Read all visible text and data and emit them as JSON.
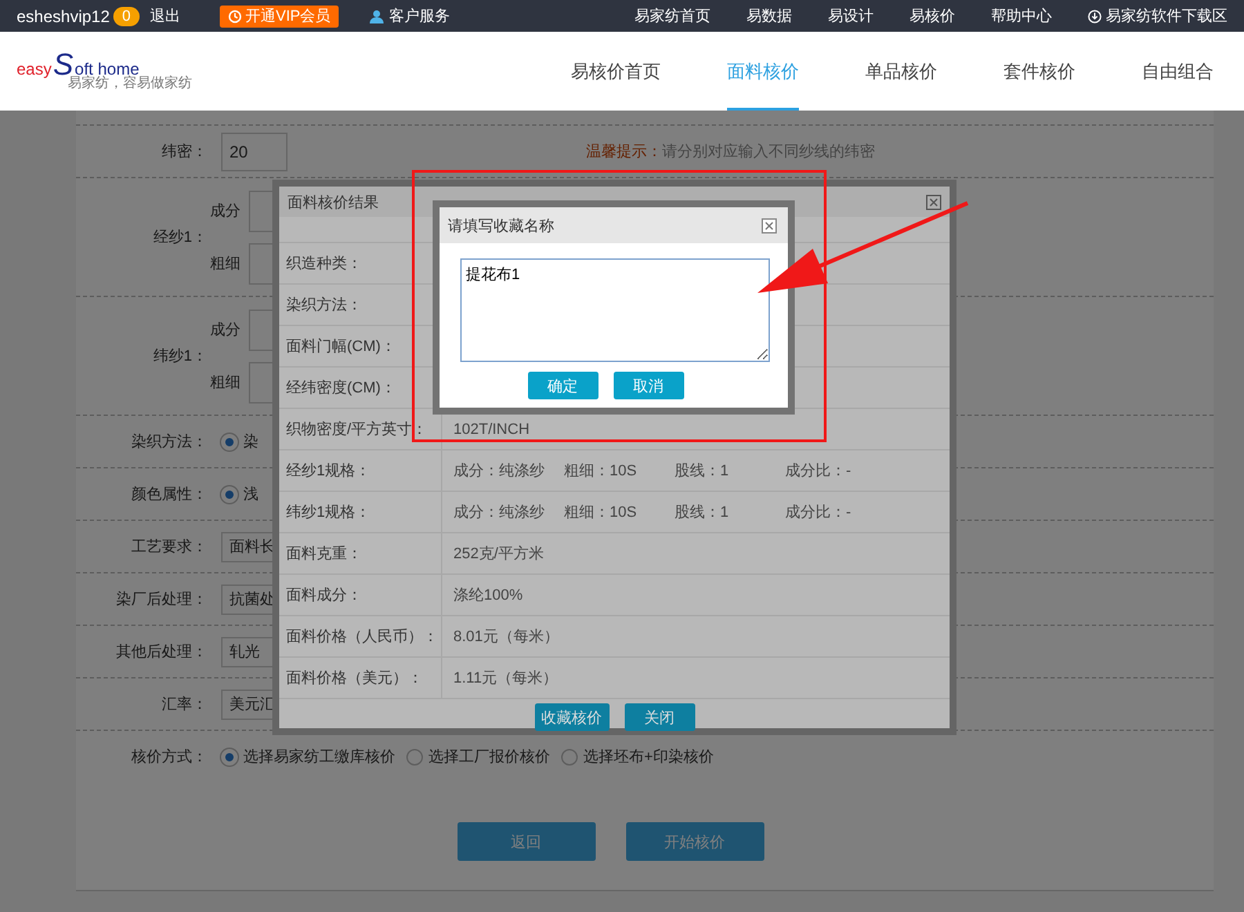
{
  "top_bar": {
    "username": "esheshvip12",
    "badge": "0",
    "logout": "退出",
    "vip_button": "开通VIP会员",
    "service": "客户服务",
    "links": [
      "易家纺首页",
      "易数据",
      "易设计",
      "易核价",
      "帮助中心"
    ],
    "download": "易家纺软件下载区"
  },
  "header": {
    "logo": {
      "word1": "easy",
      "letter": "S",
      "word2": "oft home",
      "tagline": "易家纺，容易做家纺"
    },
    "nav": [
      {
        "label": "易核价首页",
        "selected": false
      },
      {
        "label": "面料核价",
        "selected": true
      },
      {
        "label": "单品核价",
        "selected": false
      },
      {
        "label": "套件核价",
        "selected": false
      },
      {
        "label": "自由组合",
        "selected": false
      }
    ]
  },
  "form": {
    "rows": [
      {
        "kind": "input",
        "label": "纬密：",
        "value": "20",
        "hint_label": "温馨提示：",
        "hint_text": "请分别对应输入不同纱线的纬密"
      },
      {
        "kind": "yarn",
        "label": "经纱1：",
        "sub_labels": [
          "成分",
          "粗细"
        ]
      },
      {
        "kind": "yarn",
        "label": "纬纱1：",
        "sub_labels": [
          "成分",
          "粗细"
        ]
      },
      {
        "kind": "radio",
        "label": "染织方法：",
        "options": [
          {
            "label": "染",
            "selected": true
          }
        ]
      },
      {
        "kind": "radio",
        "label": "颜色属性：",
        "options": [
          {
            "label": "浅",
            "selected": true
          }
        ]
      },
      {
        "kind": "input",
        "label": "工艺要求：",
        "value": "面料长"
      },
      {
        "kind": "input",
        "label": "染厂后处理：",
        "value": "抗菌处"
      },
      {
        "kind": "input",
        "label": "其他后处理：",
        "value": "轧光"
      },
      {
        "kind": "input",
        "label": "汇率：",
        "value": "美元汇"
      },
      {
        "kind": "radio",
        "label": "核价方式：",
        "options": [
          {
            "label": "选择易家纺工缴库核价",
            "selected": true
          },
          {
            "label": "选择工厂报价核价",
            "selected": false
          },
          {
            "label": "选择坯布+印染核价",
            "selected": false
          }
        ]
      }
    ],
    "buttons": [
      "返回",
      "开始核价"
    ]
  },
  "result_dialog": {
    "title": "面料核价结果",
    "rows": [
      {
        "label": "织造种类："
      },
      {
        "label": "染织方法："
      },
      {
        "label": "面料门幅(CM)："
      },
      {
        "label": "经纬密度(CM)："
      },
      {
        "label": "织物密度/平方英寸：",
        "value": "102T/INCH"
      },
      {
        "label": "经纱1规格：",
        "parts": [
          "成分：纯涤纱",
          "粗细：10S",
          "股线：1",
          "成分比：-"
        ]
      },
      {
        "label": "纬纱1规格：",
        "parts": [
          "成分：纯涤纱",
          "粗细：10S",
          "股线：1",
          "成分比：-"
        ]
      },
      {
        "label": "面料克重：",
        "value": "252克/平方米"
      },
      {
        "label": "面料成分：",
        "value": "涤纶100%"
      },
      {
        "label": "面料价格（人民币）：",
        "value": "8.01元（每米）"
      },
      {
        "label": "面料价格（美元）：",
        "value": "1.11元（每米）"
      }
    ],
    "buttons": [
      "收藏核价",
      "关闭"
    ]
  },
  "name_dialog": {
    "title": "请填写收藏名称",
    "value": "提花布1",
    "buttons": [
      "确定",
      "取消"
    ]
  }
}
